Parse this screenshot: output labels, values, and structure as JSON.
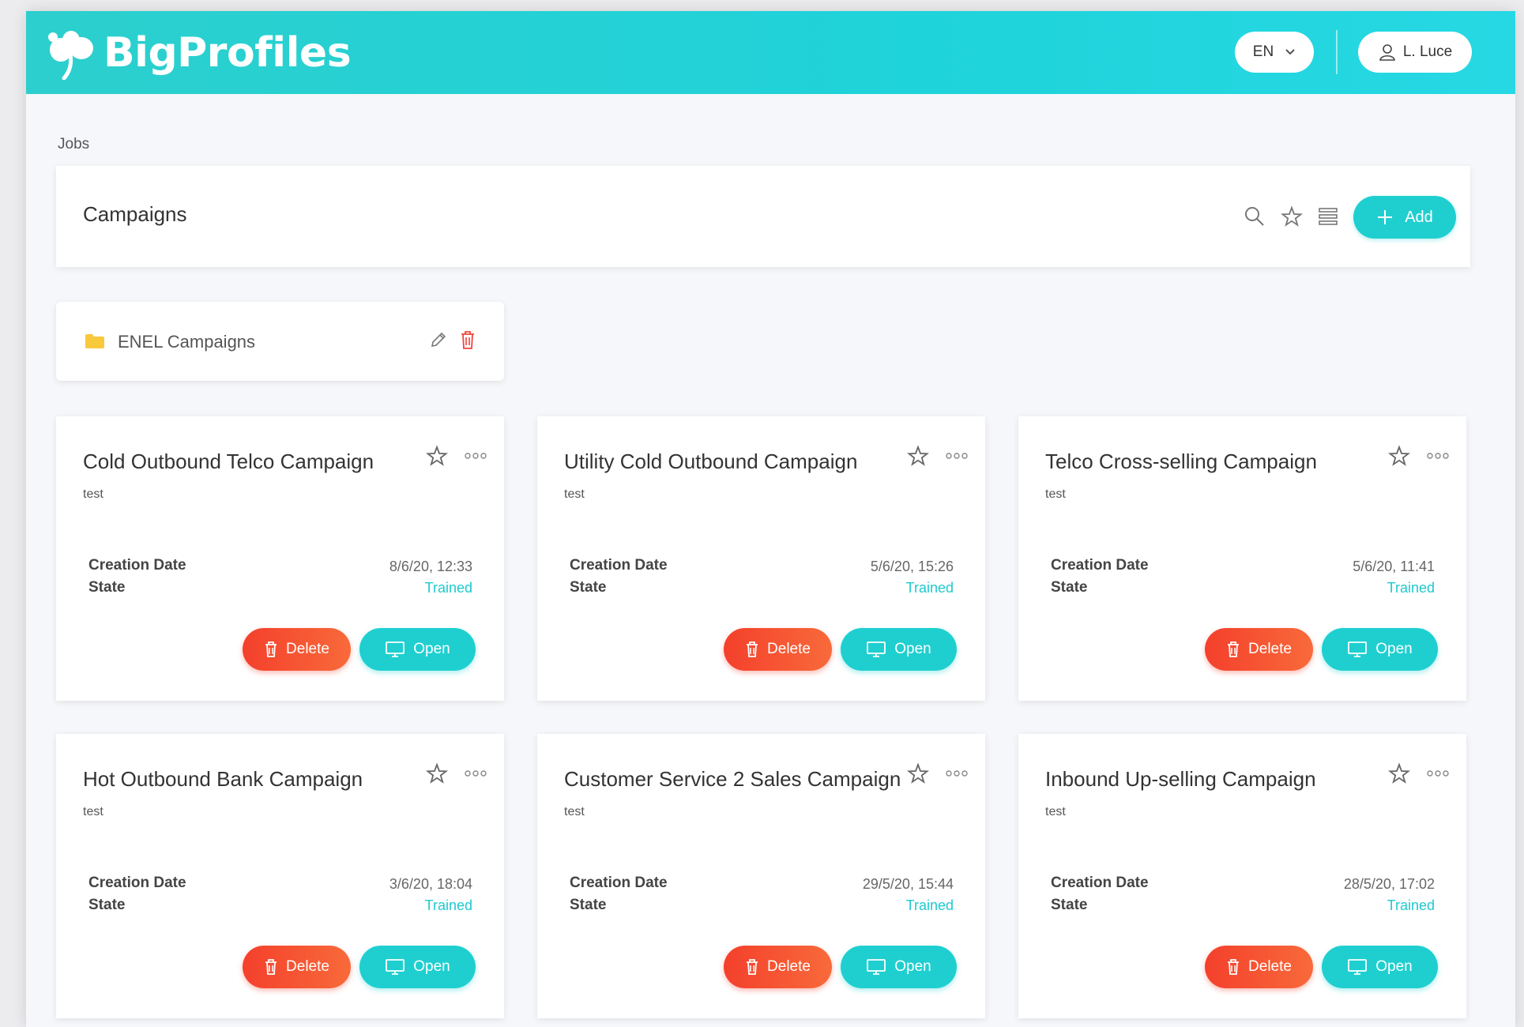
{
  "app": {
    "name": "BigProfiles"
  },
  "header": {
    "language": "EN",
    "user": "L. Luce"
  },
  "breadcrumb": "Jobs",
  "toolbar": {
    "title": "Campaigns",
    "add_label": "Add"
  },
  "folder": {
    "name": "ENEL Campaigns"
  },
  "labels": {
    "creation_date": "Creation Date",
    "state": "State",
    "delete": "Delete",
    "open": "Open"
  },
  "colors": {
    "accent": "#1fcfd0",
    "danger": "#f4402c",
    "folder": "#f8c93a"
  },
  "campaigns": [
    {
      "title": "Cold Outbound Telco Campaign",
      "description": "test",
      "creation_date": "8/6/20, 12:33",
      "state": "Trained"
    },
    {
      "title": "Utility Cold Outbound Campaign",
      "description": "test",
      "creation_date": "5/6/20, 15:26",
      "state": "Trained"
    },
    {
      "title": "Telco Cross-selling Campaign",
      "description": "test",
      "creation_date": "5/6/20, 11:41",
      "state": "Trained"
    },
    {
      "title": "Hot Outbound Bank Campaign",
      "description": "test",
      "creation_date": "3/6/20, 18:04",
      "state": "Trained"
    },
    {
      "title": "Customer Service 2 Sales Campaign",
      "description": "test",
      "creation_date": "29/5/20, 15:44",
      "state": "Trained"
    },
    {
      "title": "Inbound Up-selling Campaign",
      "description": "test",
      "creation_date": "28/5/20, 17:02",
      "state": "Trained"
    }
  ]
}
